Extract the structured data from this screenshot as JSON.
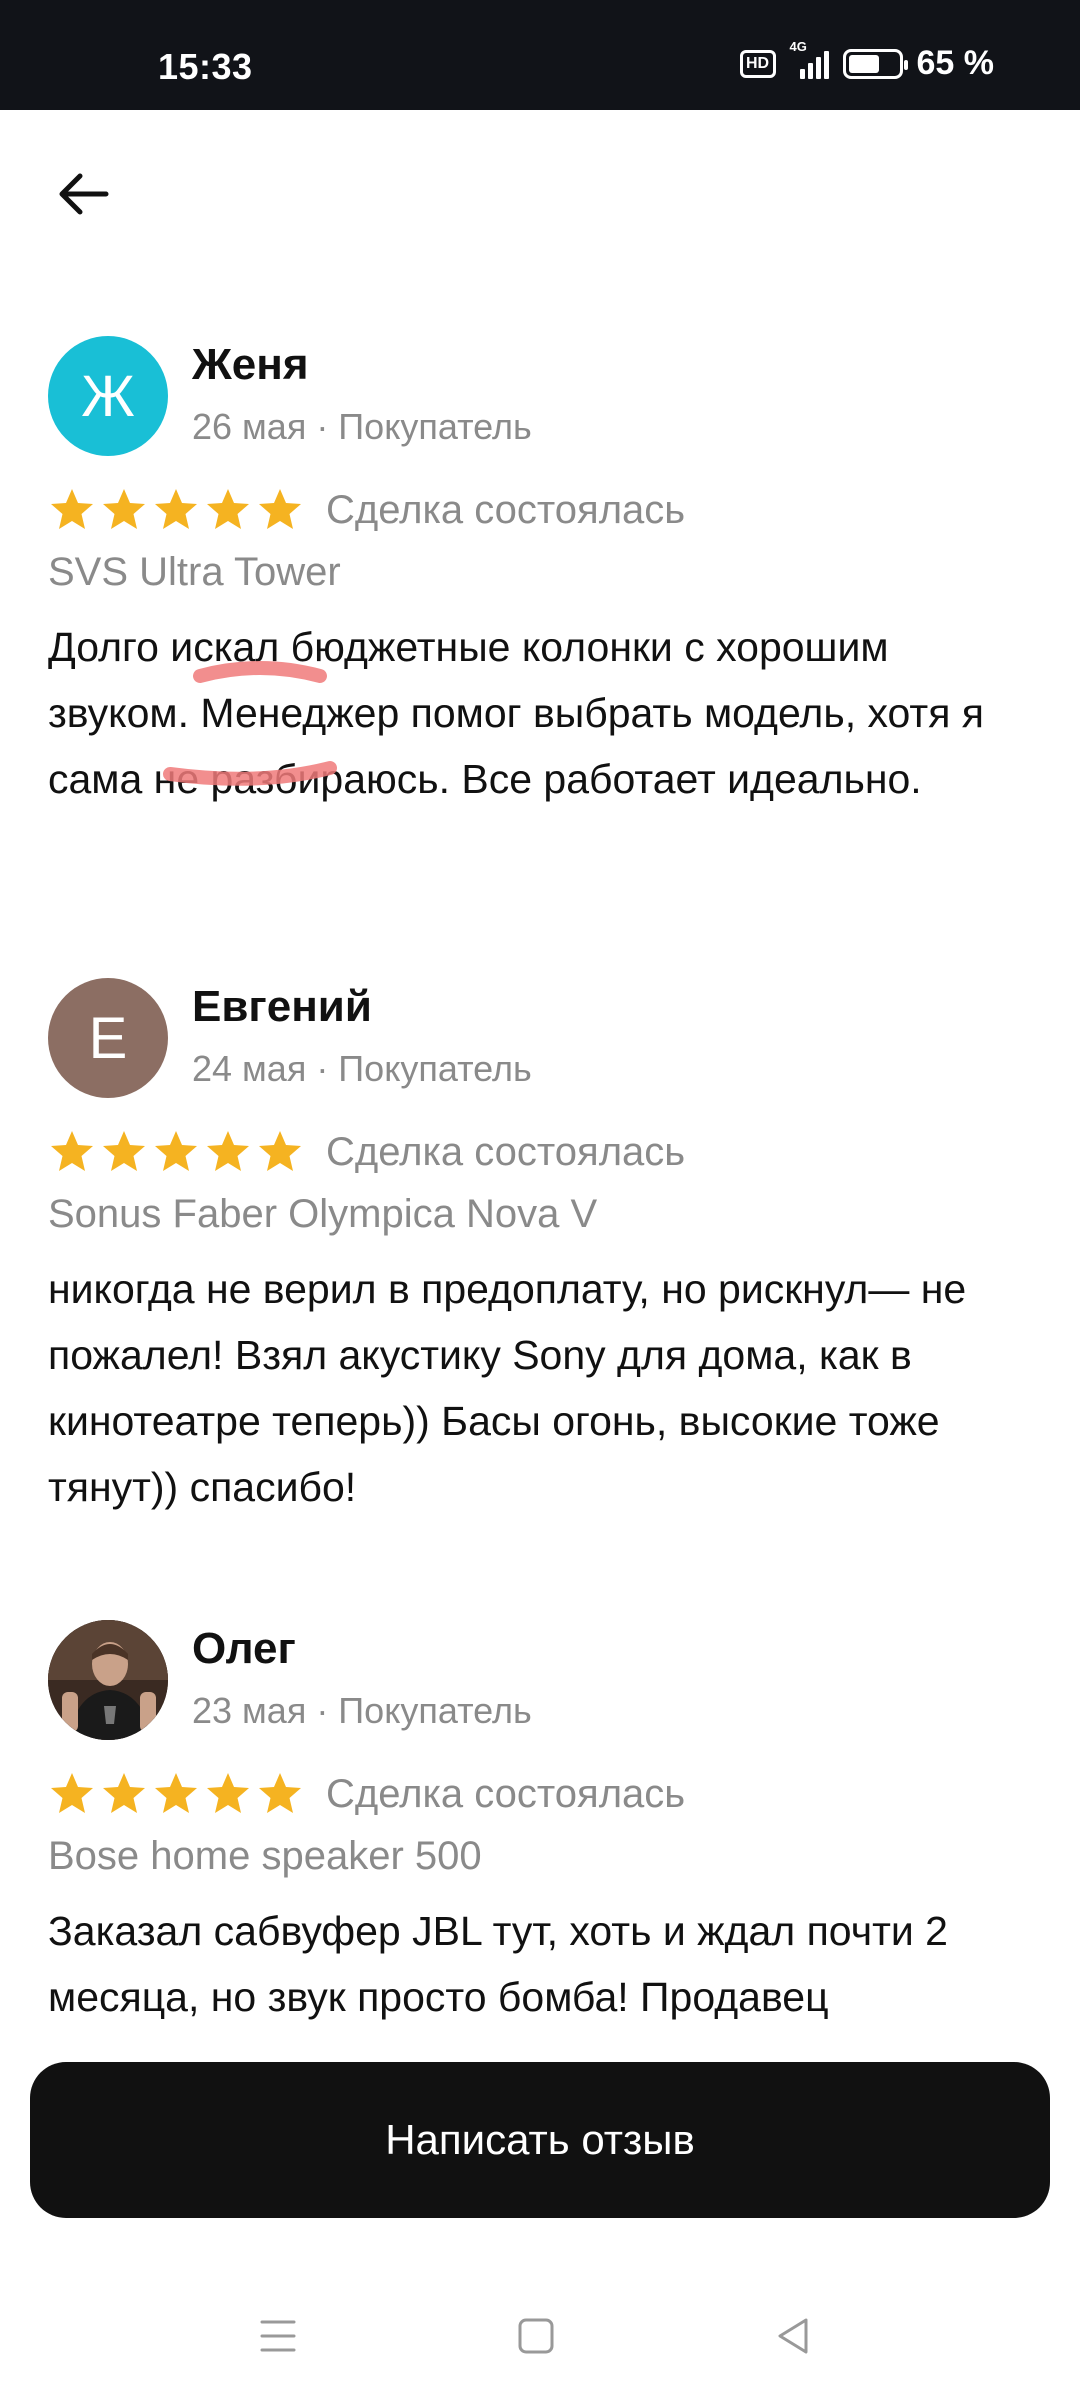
{
  "status_bar": {
    "time": "15:33",
    "hd_label": "HD",
    "network_label": "4G",
    "battery_percent": "65 %",
    "battery_level": 0.65
  },
  "header": {
    "back_icon": "arrow-left-icon"
  },
  "reviews": [
    {
      "avatar_letter": "Ж",
      "avatar_color": "#19BFD6",
      "name": "Женя",
      "meta": "26 мая · Покупатель",
      "rating": 5,
      "deal_status": "Сделка состоялась",
      "product": "SVS Ultra Tower",
      "text": "Долго искал бюджетные колонки с хорошим звуком. Менеджер помог выбрать модель, хотя я сама не разбираюсь. Все работает идеально."
    },
    {
      "avatar_letter": "Е",
      "avatar_color": "#8C6E63",
      "name": "Евгений",
      "meta": "24 мая · Покупатель",
      "rating": 5,
      "deal_status": "Сделка состоялась",
      "product": "Sonus Faber Olympica Nova V",
      "text": "никогда не верил в предоплату, но рискнул— не пожалел! Взял акустику Sony для дома, как в кинотеатре теперь)) Басы огонь, высокие тоже тянут)) спасибо!"
    },
    {
      "avatar_letter": "",
      "avatar_color": "#3a2a22",
      "name": "Олег",
      "meta": "23 мая · Покупатель",
      "rating": 5,
      "deal_status": "Сделка состоялась",
      "product": "Bose home speaker 500",
      "text": "Заказал сабвуфер JBL тут, хоть и ждал почти 2 месяца, но звук просто бомба! Продавец"
    }
  ],
  "colors": {
    "star": "#F5B321",
    "button_bg": "#111111",
    "annotation_red": "#F07A7A"
  },
  "write_review_button": "Написать отзыв",
  "navbar": {
    "menu_icon": "menu-icon",
    "home_icon": "home-square-icon",
    "back_icon": "back-triangle-icon"
  }
}
